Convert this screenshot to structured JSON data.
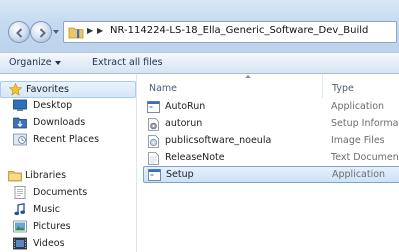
{
  "address_bar": {
    "path": "NR-114224-LS-18_Ella_Generic_Software_Dev_Build"
  },
  "toolbar": {
    "organize_label": "Organize",
    "extract_label": "Extract all files"
  },
  "nav": {
    "favorites": {
      "header": "Favorites",
      "items": [
        {
          "label": "Desktop",
          "icon": "desktop-icon"
        },
        {
          "label": "Downloads",
          "icon": "downloads-icon"
        },
        {
          "label": "Recent Places",
          "icon": "recent-places-icon"
        }
      ]
    },
    "libraries": {
      "header": "Libraries",
      "items": [
        {
          "label": "Documents",
          "icon": "documents-icon"
        },
        {
          "label": "Music",
          "icon": "music-icon"
        },
        {
          "label": "Pictures",
          "icon": "pictures-icon"
        },
        {
          "label": "Videos",
          "icon": "videos-icon"
        }
      ]
    }
  },
  "columns": {
    "name": "Name",
    "type": "Type"
  },
  "files": [
    {
      "name": "AutoRun",
      "type": "Application",
      "icon": "application-icon",
      "selected": false
    },
    {
      "name": "autorun",
      "type": "Setup Information",
      "icon": "setup-info-icon",
      "selected": false
    },
    {
      "name": "publicsoftware_noeula",
      "type": "Image Files",
      "icon": "image-file-icon",
      "selected": false
    },
    {
      "name": "ReleaseNote",
      "type": "Text Document",
      "icon": "text-document-icon",
      "selected": false
    },
    {
      "name": "Setup",
      "type": "Application",
      "icon": "application-icon",
      "selected": true
    }
  ]
}
